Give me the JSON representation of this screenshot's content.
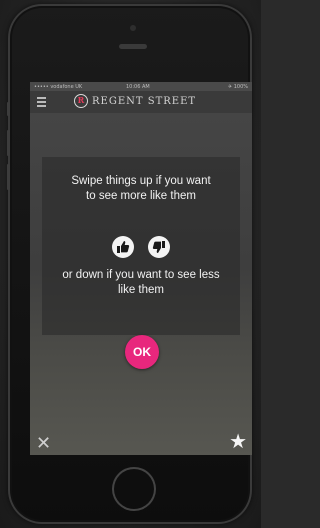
{
  "status_bar": {
    "carrier": "••••• vodafone UK",
    "time": "10:06 AM",
    "battery": "✈ 100%"
  },
  "header": {
    "logo_letter": "R",
    "brand_name": "REGENT STREET"
  },
  "onboarding": {
    "line_top": "Swipe things up if you want to see more like them",
    "line_bottom": "or down if you want to see less like them",
    "ok_label": "OK"
  },
  "icons": {
    "menu": "hamburger-icon",
    "like": "thumbs-up-icon",
    "dislike": "thumbs-down-icon",
    "close": "close-icon",
    "favorite": "star-icon"
  },
  "glyphs": {
    "close": "✕",
    "star": "★"
  },
  "colors": {
    "accent": "#e8277d",
    "logo_accent": "#e63a5a"
  }
}
